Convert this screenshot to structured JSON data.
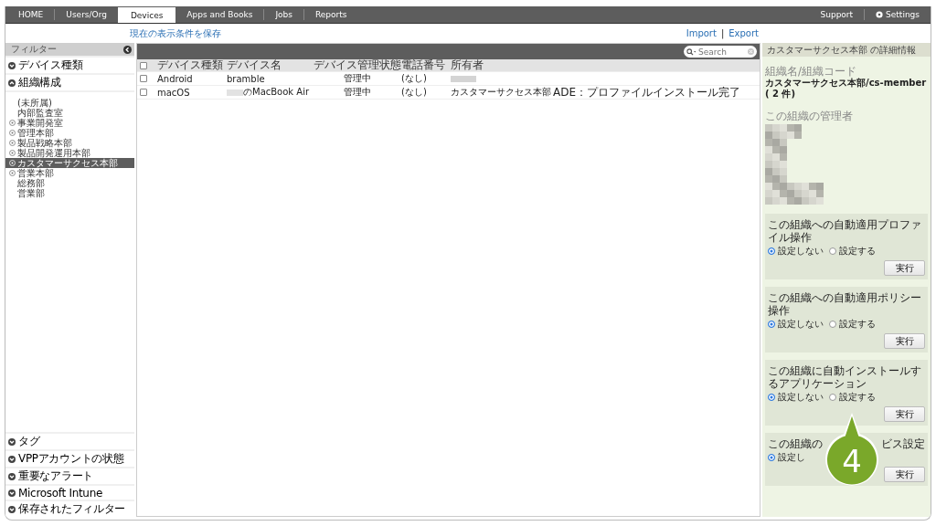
{
  "nav": {
    "tabs": [
      {
        "label": "HOME",
        "selected": false
      },
      {
        "label": "Users/Org",
        "selected": false
      },
      {
        "label": "Devices",
        "selected": true
      },
      {
        "label": "Apps and Books",
        "selected": false
      },
      {
        "label": "Jobs",
        "selected": false
      },
      {
        "label": "Reports",
        "selected": false
      }
    ],
    "right_links": [
      {
        "label": "Support",
        "kind": "text"
      },
      {
        "label": "Settings",
        "kind": "gear"
      }
    ]
  },
  "save_view_link": "現在の表示条件を保存",
  "import_link": "Import",
  "export_link": "Export",
  "link_separator": "|",
  "sidebar": {
    "title": "フィルター",
    "top_sections": [
      {
        "label": "デバイス種類",
        "expanded": false
      },
      {
        "label": "組織構成",
        "expanded": true
      }
    ],
    "tree": [
      {
        "label": "(未所属)",
        "expandable": false,
        "selected": false
      },
      {
        "label": "内部監査室",
        "expandable": false,
        "selected": false
      },
      {
        "label": "事業開発室",
        "expandable": true,
        "selected": false
      },
      {
        "label": "管理本部",
        "expandable": true,
        "selected": false
      },
      {
        "label": "製品戦略本部",
        "expandable": true,
        "selected": false
      },
      {
        "label": "製品開発運用本部",
        "expandable": true,
        "selected": false
      },
      {
        "label": "カスタマーサクセス本部",
        "expandable": true,
        "selected": true
      },
      {
        "label": "営業本部",
        "expandable": true,
        "selected": false
      },
      {
        "label": "総務部",
        "expandable": false,
        "selected": false
      },
      {
        "label": "営業部",
        "expandable": false,
        "selected": false
      }
    ],
    "bottom_sections": [
      {
        "label": "タグ",
        "expanded": false
      },
      {
        "label": "VPPアカウントの状態",
        "expanded": false
      },
      {
        "label": "重要なアラート",
        "expanded": false
      },
      {
        "label": "Microsoft Intune",
        "expanded": false
      },
      {
        "label": "保存されたフィルター",
        "expanded": false
      }
    ]
  },
  "table": {
    "search": {
      "placeholder": "Search"
    },
    "header_checked": false,
    "columns": [
      "デバイス種類",
      "デバイス名",
      "デバイス管理状態",
      "電話番号",
      "所有者"
    ],
    "rows": [
      {
        "checked": false,
        "type": "Android",
        "name": "bramble",
        "name_redacted_prefix": false,
        "status": "管理中",
        "phone": "(なし)",
        "owner_redacted": true,
        "owner": "",
        "column_7": ""
      },
      {
        "checked": false,
        "type": "macOS",
        "name": "のMacBook Air",
        "name_redacted_prefix": true,
        "status": "管理中",
        "phone": "(なし)",
        "owner_redacted": false,
        "owner": "カスタマーサクセス本部",
        "column_7": "ADE：プロファイルインストール完了"
      }
    ]
  },
  "detail": {
    "title": "カスタマーサクセス本部 の詳細情報",
    "name_label": "組織名/組織コード",
    "name_value": "カスタマーサクセス本部/cs-member",
    "count": "( 2 件)",
    "admin_label": "この組織の管理者",
    "panels": [
      {
        "title_parts": [
          "この組織への自動適用プロファイル操作"
        ],
        "options": [
          {
            "label": "設定しない",
            "selected": true
          },
          {
            "label": "設定する",
            "selected": false
          }
        ],
        "button": "実行"
      },
      {
        "title_parts": [
          "この組織への自動適用ポリシー操作"
        ],
        "options": [
          {
            "label": "設定しない",
            "selected": true
          },
          {
            "label": "設定する",
            "selected": false
          }
        ],
        "button": "実行"
      },
      {
        "title_parts": [
          "この組織に自動インストールするアプリケーション"
        ],
        "options": [
          {
            "label": "設定しない",
            "selected": true
          },
          {
            "label": "設定する",
            "selected": false
          }
        ],
        "button": "実行"
      },
      {
        "title_parts": [
          "この組織の",
          "ビス設定"
        ],
        "options": [
          {
            "label": "設定し",
            "selected": true
          }
        ],
        "button": "実行"
      }
    ]
  },
  "callout": {
    "number": "4"
  }
}
